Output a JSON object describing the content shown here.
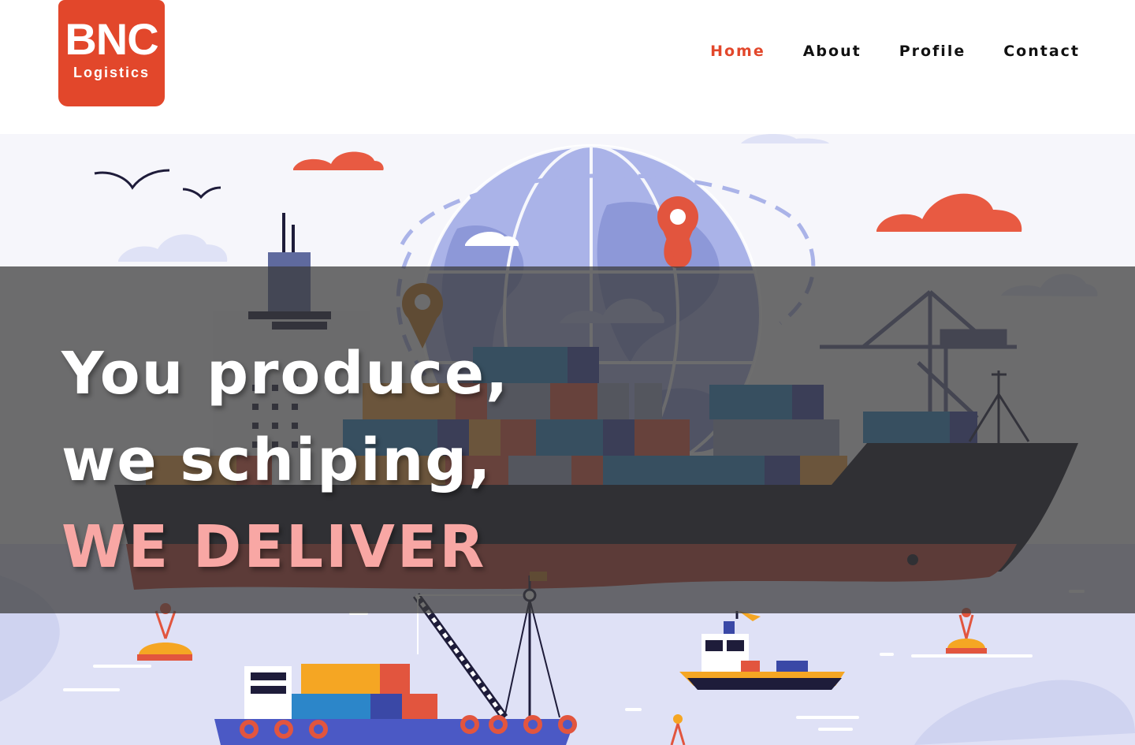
{
  "brand": {
    "logo_main": "BNC",
    "logo_sub": "Logistics",
    "accent_color": "#e2472b"
  },
  "nav": {
    "items": [
      {
        "label": "Home",
        "active": true
      },
      {
        "label": "About",
        "active": false
      },
      {
        "label": "Profile",
        "active": false
      },
      {
        "label": "Contact",
        "active": false
      }
    ]
  },
  "hero": {
    "line1": "You produce,",
    "line2": "we schiping,",
    "line3": "WE DELIVER",
    "accent_text_color": "#f8a7a4",
    "illustration": "cargo-ship-globe-illustration"
  }
}
